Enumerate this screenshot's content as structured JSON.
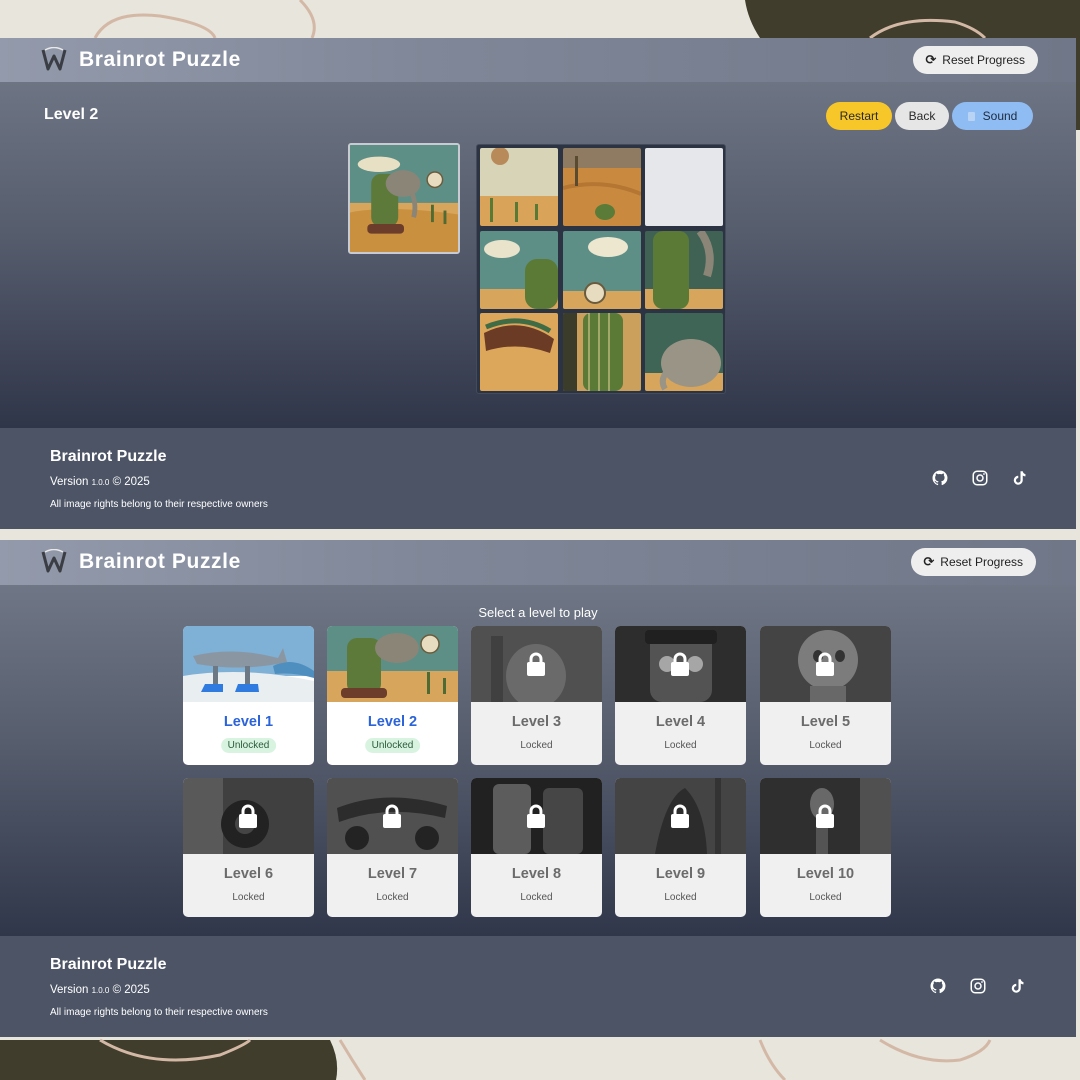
{
  "app": {
    "title": "Brainrot Puzzle"
  },
  "header": {
    "reset_label": "Reset Progress"
  },
  "game": {
    "level_title": "Level 2",
    "restart_label": "Restart",
    "back_label": "Back",
    "sound_label": "Sound",
    "board": {
      "rows": 3,
      "cols": 3,
      "tiles": [
        "sky-clock",
        "sand-cactus",
        "empty",
        "cloud-cactus",
        "cloud-clock",
        "cactus-trunk",
        "sandal",
        "cactus-leg",
        "elephant-head"
      ]
    }
  },
  "level_select": {
    "prompt": "Select a level to play",
    "levels": [
      {
        "name": "Level 1",
        "status": "Unlocked"
      },
      {
        "name": "Level 2",
        "status": "Unlocked"
      },
      {
        "name": "Level 3",
        "status": "Locked"
      },
      {
        "name": "Level 4",
        "status": "Locked"
      },
      {
        "name": "Level 5",
        "status": "Locked"
      },
      {
        "name": "Level 6",
        "status": "Locked"
      },
      {
        "name": "Level 7",
        "status": "Locked"
      },
      {
        "name": "Level 8",
        "status": "Locked"
      },
      {
        "name": "Level 9",
        "status": "Locked"
      },
      {
        "name": "Level 10",
        "status": "Locked"
      }
    ]
  },
  "footer": {
    "title": "Brainrot Puzzle",
    "version_prefix": "Version",
    "version_number": "1.0.0",
    "version_suffix": "© 2025",
    "rights": "All image rights belong to their respective owners",
    "social_icons": [
      "github-icon",
      "instagram-icon",
      "tiktok-icon"
    ]
  },
  "colors": {
    "restart": "#f7c72a",
    "sound": "#8fbcf3",
    "unlocked_name": "#2b63d9",
    "unlocked_badge": "#d8f4e1"
  }
}
